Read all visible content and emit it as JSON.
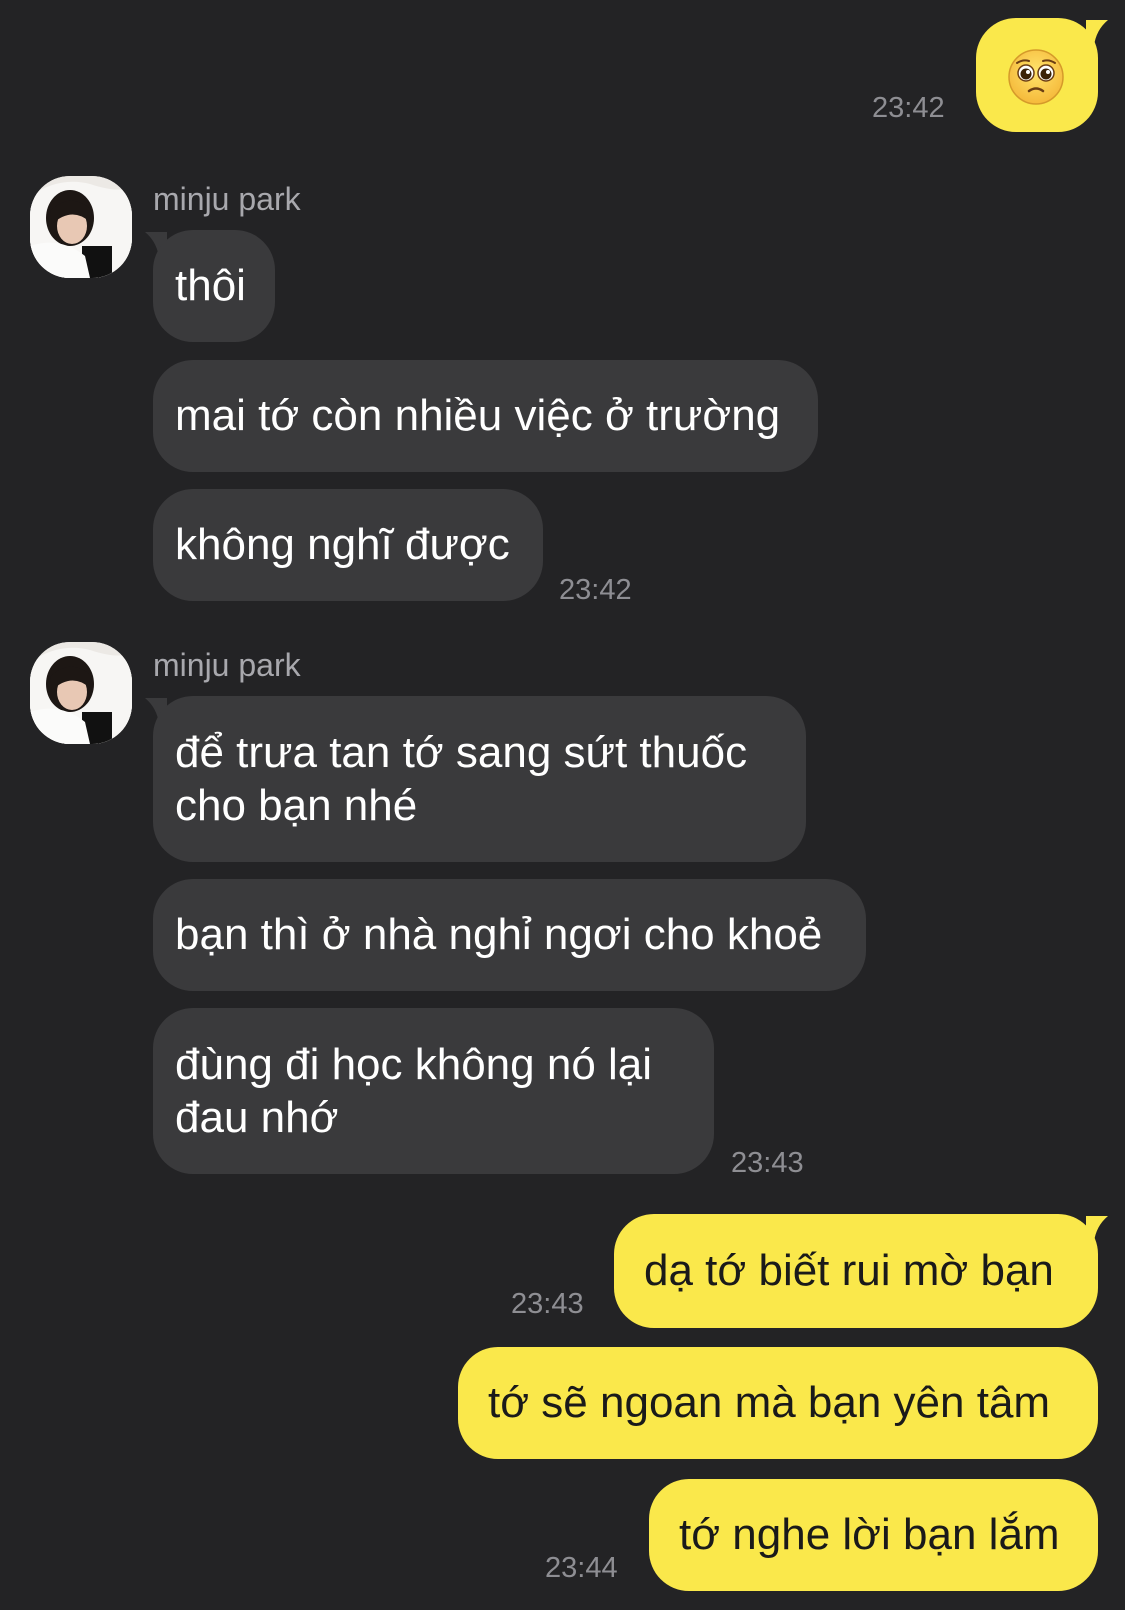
{
  "colors": {
    "background": "#232325",
    "incoming_bubble": "#3a3a3c",
    "outgoing_bubble": "#fae84b",
    "timestamp": "#8e8e93",
    "sender_name": "#a8a8ad"
  },
  "messages": [
    {
      "side": "out",
      "emoji_icon": "pleading-face-emoji",
      "time": "23:42"
    },
    {
      "side": "in",
      "sender": "minju park",
      "avatar": "avatar-photo",
      "lines": [
        "thôi"
      ]
    },
    {
      "side": "in",
      "lines": [
        "mai tớ còn nhiều việc ở trường"
      ]
    },
    {
      "side": "in",
      "lines": [
        "không nghĩ được"
      ],
      "time": "23:42"
    },
    {
      "side": "in",
      "sender": "minju park",
      "avatar": "avatar-photo",
      "lines": [
        "để trưa tan tớ sang sứt thuốc",
        "cho bạn nhé"
      ]
    },
    {
      "side": "in",
      "lines": [
        "bạn thì ở nhà nghỉ ngơi cho khoẻ"
      ]
    },
    {
      "side": "in",
      "lines": [
        "đùng đi học không nó lại",
        "đau nhớ"
      ],
      "time": "23:43"
    },
    {
      "side": "out",
      "lines": [
        "dạ tớ biết rui mờ bạn"
      ],
      "time": "23:43"
    },
    {
      "side": "out",
      "lines": [
        "tớ sẽ ngoan mà bạn yên tâm"
      ]
    },
    {
      "side": "out",
      "lines": [
        "tớ nghe lời bạn lắm"
      ],
      "time": "23:44"
    }
  ]
}
